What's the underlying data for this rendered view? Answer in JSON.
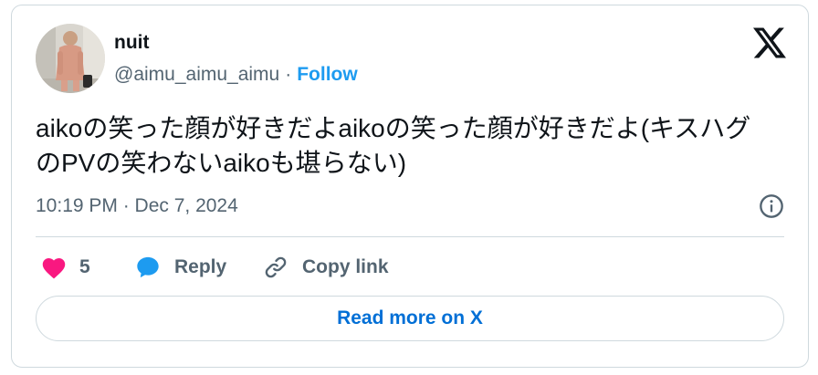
{
  "author": {
    "display_name": "nuit",
    "handle": "@aimu_aimu_aimu",
    "separator": "·",
    "follow_label": "Follow"
  },
  "tweet": {
    "text": "aikoの笑った顔が好きだよaikoの笑った顔が好きだよ(キスハグのPVの笑わないaikoも堪らない)",
    "timestamp": "10:19 PM · Dec 7, 2024"
  },
  "actions": {
    "like_count": "5",
    "reply_label": "Reply",
    "copy_link_label": "Copy link"
  },
  "read_more_label": "Read more on X",
  "colors": {
    "text_primary": "#0f1419",
    "text_secondary": "#536471",
    "link_blue": "#1d9bf0",
    "heart_pink": "#f91880",
    "border": "#cfd9de"
  },
  "icons": [
    "x-logo-icon",
    "info-icon",
    "heart-icon",
    "reply-bubble-icon",
    "link-icon"
  ]
}
